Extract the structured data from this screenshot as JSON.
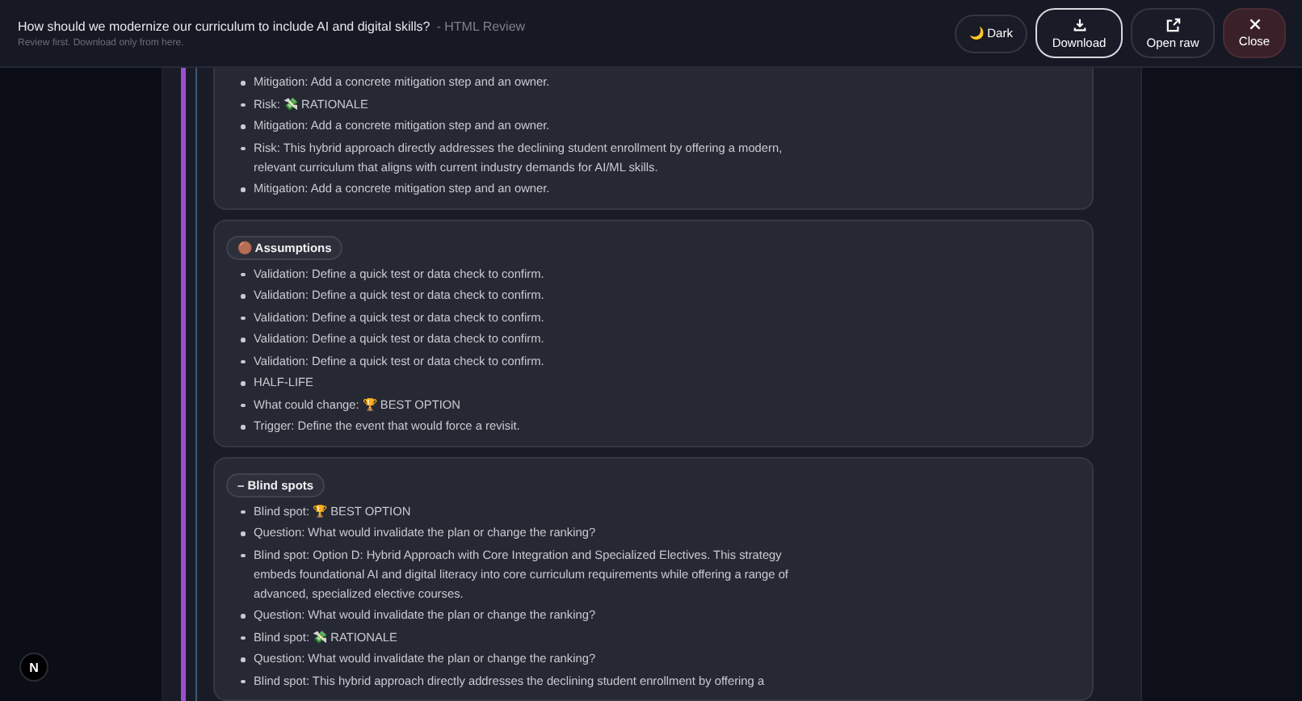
{
  "header": {
    "title": "How should we modernize our curriculum to include AI and digital skills?",
    "subtitle": "- HTML Review",
    "note": "Review first. Download only from here."
  },
  "buttons": [
    {
      "kind": "theme",
      "label": "🌙 Dark"
    },
    {
      "kind": "download",
      "label": "Download"
    },
    {
      "kind": "open",
      "label": "Open raw"
    },
    {
      "kind": "close",
      "label": "Close"
    }
  ],
  "sections": [
    {
      "items": [
        "Mitigation: Add a concrete mitigation step and an owner.",
        "Risk: 💸 RATIONALE",
        "Mitigation: Add a concrete mitigation step and an owner.",
        "Risk: This hybrid approach directly addresses the declining student enrollment by offering a modern, relevant curriculum that aligns with current industry demands for AI/ML skills.",
        "Mitigation: Add a concrete mitigation step and an owner."
      ]
    },
    {
      "heading": "🟤 Assumptions",
      "items": [
        "Validation: Define a quick test or data check to confirm.",
        "Validation: Define a quick test or data check to confirm.",
        "Validation: Define a quick test or data check to confirm.",
        "Validation: Define a quick test or data check to confirm.",
        "Validation: Define a quick test or data check to confirm.",
        "HALF-LIFE",
        "What could change: 🏆 BEST OPTION",
        "Trigger: Define the event that would force a revisit."
      ]
    },
    {
      "heading": "– Blind spots",
      "items": [
        "Blind spot: 🏆 BEST OPTION",
        "Question: What would invalidate the plan or change the ranking?",
        "Blind spot: Option D: Hybrid Approach with Core Integration and Specialized Electives. This strategy embeds foundational AI and digital literacy into core curriculum requirements while offering a range of advanced, specialized elective courses.",
        "Question: What would invalidate the plan or change the ranking?",
        "Blind spot: 💸 RATIONALE",
        "Question: What would invalidate the plan or change the ranking?",
        "Blind spot: This hybrid approach directly addresses the declining student enrollment by offering a"
      ]
    }
  ],
  "badge": "N"
}
